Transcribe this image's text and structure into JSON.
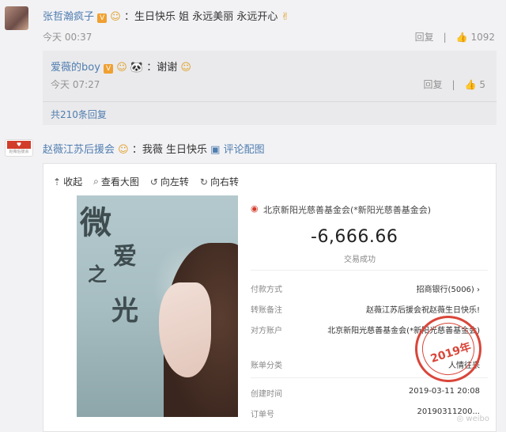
{
  "comment1": {
    "username": "张哲瀚疯子",
    "text": "：生日快乐 姐 永远美丽 永远开心",
    "time": "今天 00:37",
    "reply_label": "回复",
    "like_count": "1092"
  },
  "reply": {
    "username": "爱薇的boy",
    "text": "：谢谢",
    "time": "今天 07:27",
    "reply_label": "回复",
    "like_count": "5",
    "more_replies": "共210条回复"
  },
  "comment2": {
    "avatar_text": "赵薇后援会",
    "username": "赵薇江苏后援会",
    "text": "：我薇 生日快乐",
    "image_link": "评论配图"
  },
  "viewer": {
    "toolbar": {
      "collapse": "收起",
      "view_large": "查看大图",
      "rotate_left": "向左转",
      "rotate_right": "向右转"
    },
    "photo": {
      "calligraphy": [
        "微",
        "爱",
        "之",
        "光"
      ]
    },
    "receipt": {
      "org": "北京新阳光慈善基金会(*新阳光慈善基金会)",
      "amount": "-6,666.66",
      "status": "交易成功",
      "rows": [
        {
          "label": "付款方式",
          "value": "招商银行(5006) ›"
        },
        {
          "label": "转账备注",
          "value": "赵薇江苏后援会祝赵薇生日快乐!"
        },
        {
          "label": "对方账户",
          "value": "北京新阳光慈善基金会(*新阳光慈善基金会)"
        },
        {
          "label": "账单分类",
          "value": "人情往来"
        },
        {
          "label": "创建时间",
          "value": "2019-03-11 20:08"
        },
        {
          "label": "订单号",
          "value": "20190311200..."
        }
      ],
      "stamp": "2019年"
    }
  }
}
